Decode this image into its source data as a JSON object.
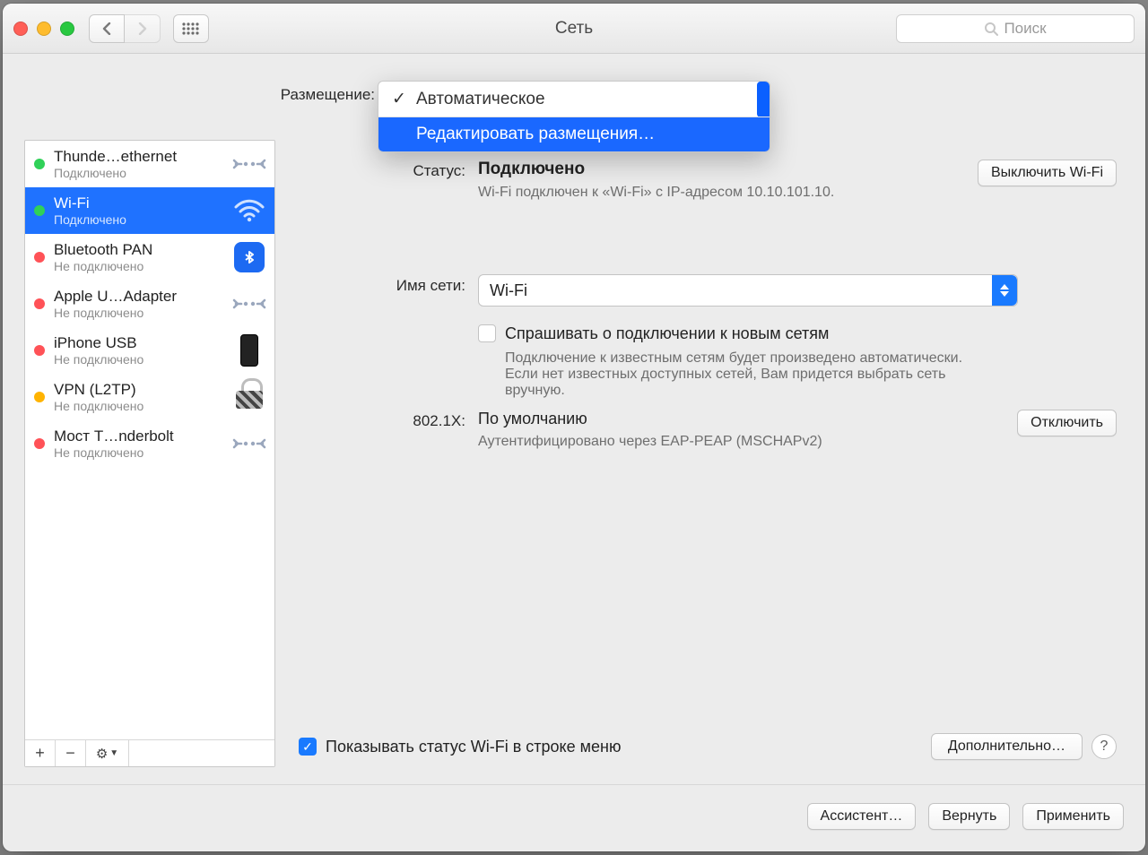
{
  "window": {
    "title": "Сеть"
  },
  "search": {
    "placeholder": "Поиск"
  },
  "location": {
    "label": "Размещение:",
    "menu": {
      "selected": "Автоматическое",
      "edit": "Редактировать размещения…"
    }
  },
  "sidebar": {
    "items": [
      {
        "name": "Thunde…ethernet",
        "sub": "Подключено",
        "state": "green",
        "icon": "ethernet"
      },
      {
        "name": "Wi-Fi",
        "sub": "Подключено",
        "state": "green",
        "icon": "wifi",
        "selected": true
      },
      {
        "name": "Bluetooth PAN",
        "sub": "Не подключено",
        "state": "red",
        "icon": "bluetooth"
      },
      {
        "name": "Apple U…Adapter",
        "sub": "Не подключено",
        "state": "red",
        "icon": "ethernet"
      },
      {
        "name": "iPhone USB",
        "sub": "Не подключено",
        "state": "red",
        "icon": "phone"
      },
      {
        "name": "VPN (L2TP)",
        "sub": "Не подключено",
        "state": "amber",
        "icon": "lock"
      },
      {
        "name": "Мост T…nderbolt",
        "sub": "Не подключено",
        "state": "red",
        "icon": "ethernet"
      }
    ],
    "footer": {
      "add": "+",
      "remove": "−",
      "gear": "⚙︎▾"
    }
  },
  "detail": {
    "status": {
      "label": "Статус:",
      "value": "Подключено",
      "desc": "Wi-Fi подключен к «Wi-Fi» с IP-адресом 10.10.101.10.",
      "toggle": "Выключить Wi-Fi"
    },
    "network": {
      "label": "Имя сети:",
      "value": "Wi-Fi",
      "ask_label": "Спрашивать о подключении к новым сетям",
      "ask_desc": "Подключение к известным сетям будет произведено автоматически. Если нет известных доступных сетей, Вам придется выбрать сеть вручную."
    },
    "dot1x": {
      "label": "802.1X:",
      "value": "По умолчанию",
      "desc": "Аутентифицировано через EAP-PEAP (MSCHAPv2)",
      "button": "Отключить"
    },
    "menubar": {
      "label": "Показывать статус Wi-Fi в строке меню"
    },
    "advanced": "Дополнительно…"
  },
  "footer": {
    "assistant": "Ассистент…",
    "revert": "Вернуть",
    "apply": "Применить"
  }
}
